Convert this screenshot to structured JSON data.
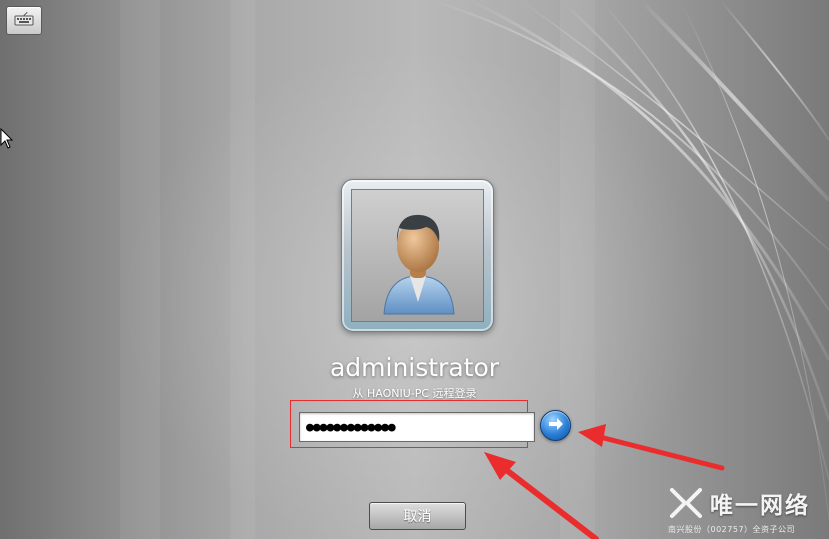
{
  "login": {
    "username": "administrator",
    "subtitle": "从 HAONIU-PC 远程登录",
    "password_mask": "●●●●●●●●●●●●●",
    "cancel_label": "取消"
  },
  "icons": {
    "keyboard": "on-screen-keyboard-icon",
    "user": "default-user-avatar-icon",
    "submit": "arrow-right-icon",
    "cursor": "mouse-pointer-icon"
  },
  "watermark": {
    "title": "唯一网络",
    "subtitle": "南兴股份（002757）全资子公司"
  },
  "colors": {
    "annotation": "#ea2c2c",
    "submit_blue": "#2a7fd6"
  }
}
